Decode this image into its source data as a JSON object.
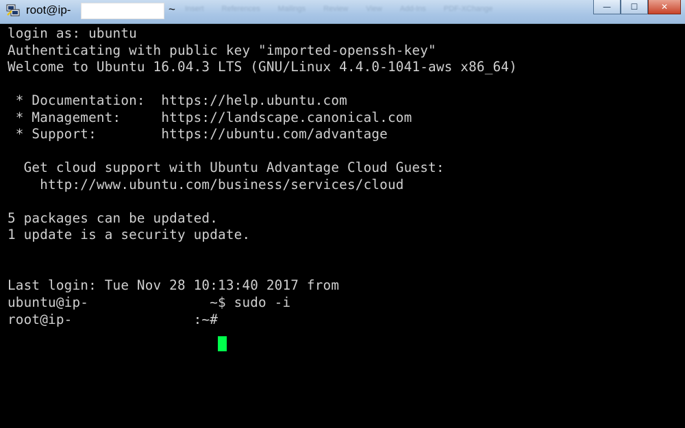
{
  "window": {
    "title_prefix": "root@ip-",
    "title_suffix": "~",
    "background_tabs": [
      "Insert",
      "References",
      "Mailings",
      "Review",
      "View",
      "Add-Ins",
      "PDF-XChange"
    ],
    "buttons": {
      "minimize": "—",
      "maximize": "☐",
      "close": "✕"
    },
    "colors": {
      "titlebar": "#a9c6e6",
      "terminal_bg": "#000000",
      "terminal_fg": "#d0d0d0",
      "cursor": "#00ff4c"
    }
  },
  "terminal": {
    "lines": [
      "login as: ubuntu",
      "Authenticating with public key \"imported-openssh-key\"",
      "Welcome to Ubuntu 16.04.3 LTS (GNU/Linux 4.4.0-1041-aws x86_64)",
      "",
      " * Documentation:  https://help.ubuntu.com",
      " * Management:     https://landscape.canonical.com",
      " * Support:        https://ubuntu.com/advantage",
      "",
      "  Get cloud support with Ubuntu Advantage Cloud Guest:",
      "    http://www.ubuntu.com/business/services/cloud",
      "",
      "5 packages can be updated.",
      "1 update is a security update.",
      "",
      "",
      "Last login: Tue Nov 28 10:13:40 2017 from",
      "ubuntu@ip-               ~$ sudo -i",
      "root@ip-               :~# "
    ]
  }
}
